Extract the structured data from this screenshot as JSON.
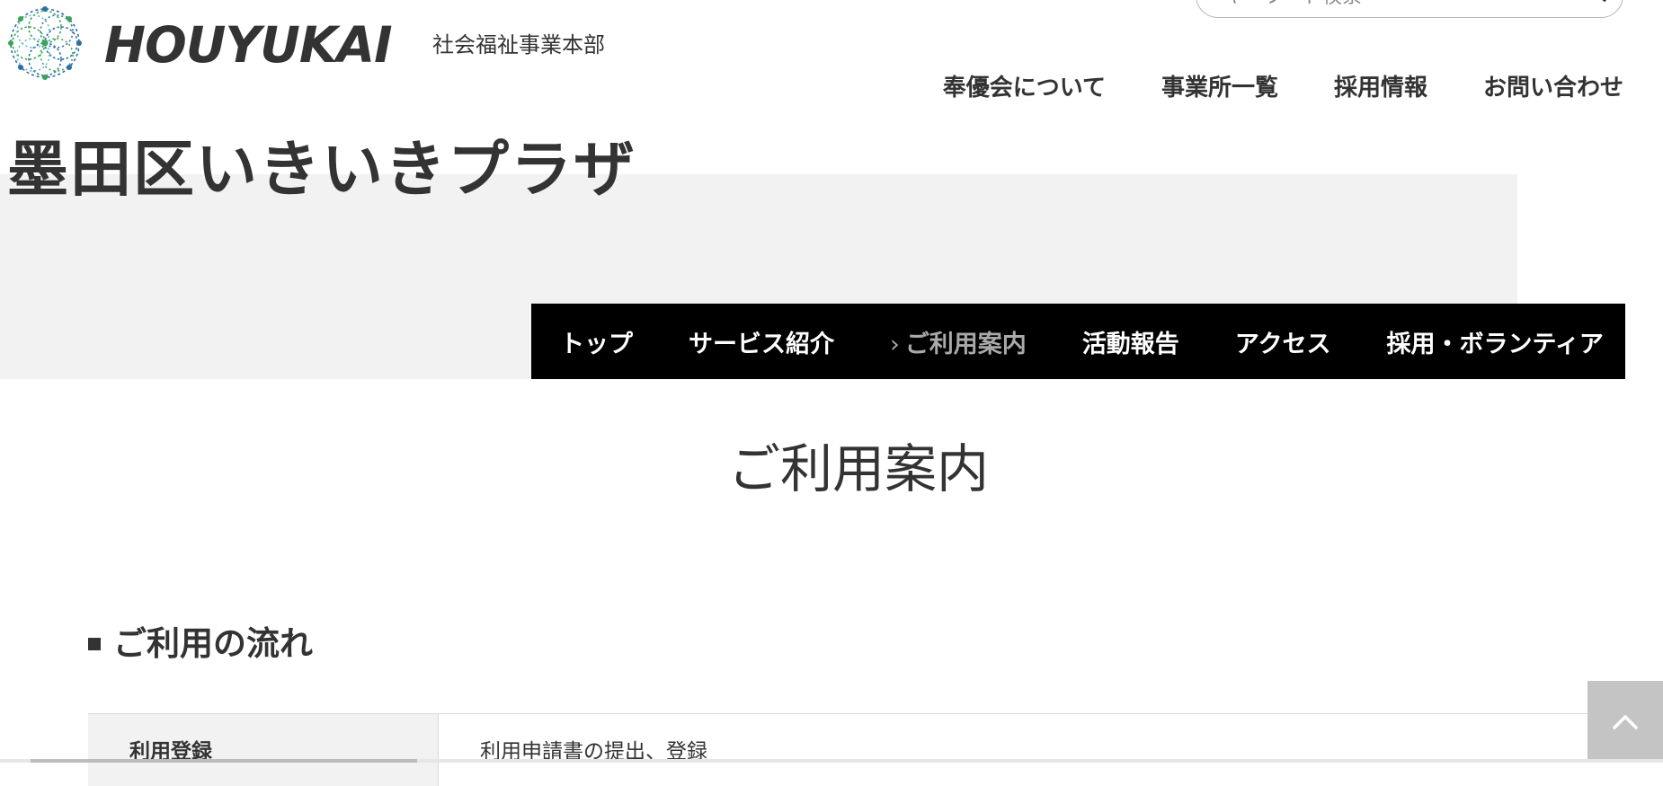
{
  "header": {
    "logo_text": "HOUYUKAI",
    "logo_subtitle": "社会福祉事業本部",
    "search": {
      "placeholder": "キーワード検索"
    },
    "nav": [
      "奉優会について",
      "事業所一覧",
      "採用情報",
      "お問い合わせ"
    ]
  },
  "hero": {
    "page_title": "墨田区いきいきプラザ"
  },
  "sub_nav": {
    "items": [
      {
        "label": "トップ",
        "active": false
      },
      {
        "label": "サービス紹介",
        "active": false
      },
      {
        "label": "ご利用案内",
        "active": true,
        "marker": "›"
      },
      {
        "label": "活動報告",
        "active": false
      },
      {
        "label": "アクセス",
        "active": false
      },
      {
        "label": "採用・ボランティア",
        "active": false
      }
    ]
  },
  "main": {
    "section_title": "ご利用案内",
    "flow_heading": "ご利用の流れ",
    "table": {
      "rows": [
        {
          "label": "利用登録",
          "value": "利用申請書の提出、登録"
        }
      ]
    }
  },
  "colors": {
    "text": "#333333",
    "hero_band": "#f2f2f2",
    "sub_nav_bg": "#000000",
    "sub_nav_active": "#a9a9a9",
    "logo_green": "#3aa655",
    "logo_blue": "#2d6fa3"
  },
  "icons": {
    "search": "search-icon",
    "back_to_top": "chevron-up-icon",
    "logo": "logo-mark-icon"
  }
}
